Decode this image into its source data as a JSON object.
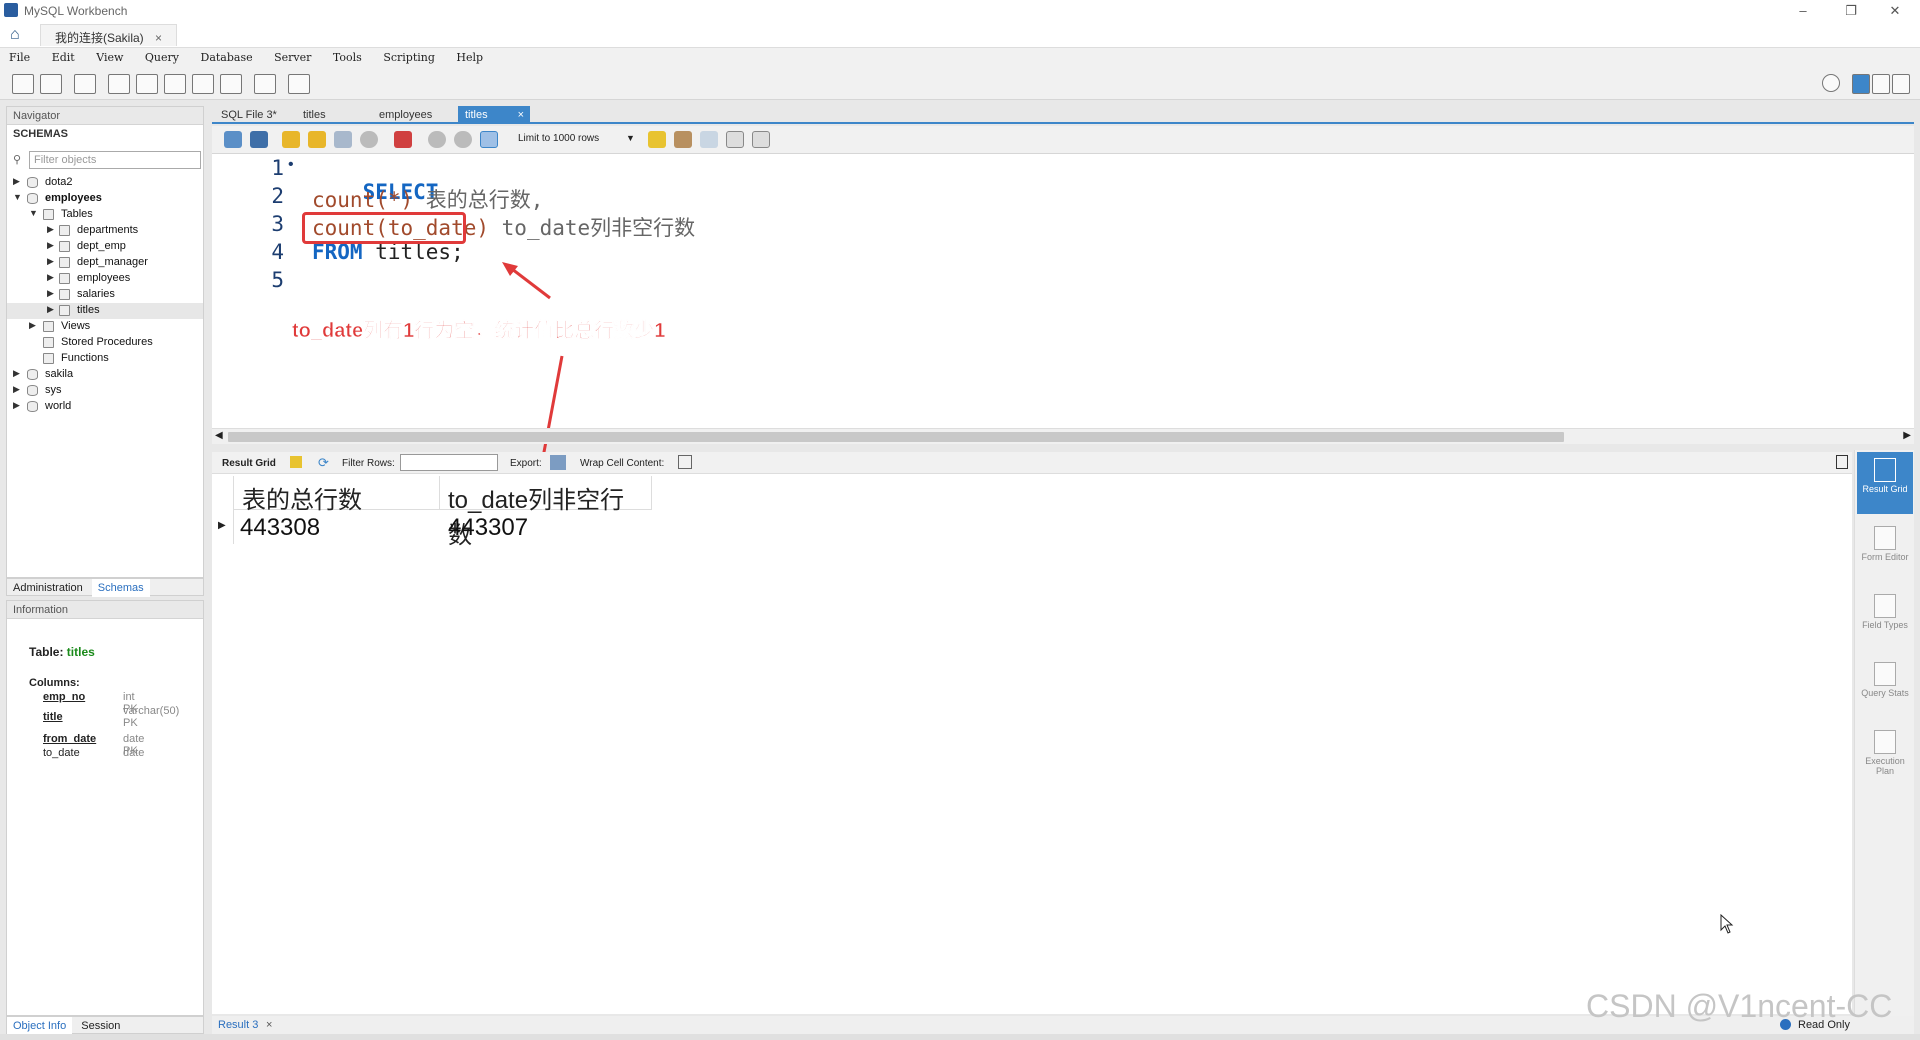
{
  "window": {
    "title": "MySQL Workbench",
    "minimize": "–",
    "restore": "❐",
    "close": "✕"
  },
  "connection_tab": {
    "label": "我的连接(Sakila)",
    "close": "×"
  },
  "menu": [
    "File",
    "Edit",
    "View",
    "Query",
    "Database",
    "Server",
    "Tools",
    "Scripting",
    "Help"
  ],
  "navigator": {
    "header": "Navigator",
    "schemas_label": "SCHEMAS",
    "filter_placeholder": "Filter objects",
    "schemas": [
      {
        "name": "dota2",
        "expanded": false
      },
      {
        "name": "employees",
        "expanded": true,
        "bold": true,
        "groups": [
          {
            "name": "Tables",
            "expanded": true,
            "items": [
              "departments",
              "dept_emp",
              "dept_manager",
              "employees",
              "salaries",
              "titles"
            ],
            "selected": "titles"
          },
          {
            "name": "Views",
            "expanded": false
          },
          {
            "name": "Stored Procedures"
          },
          {
            "name": "Functions"
          }
        ]
      },
      {
        "name": "sakila",
        "expanded": false
      },
      {
        "name": "sys",
        "expanded": false
      },
      {
        "name": "world",
        "expanded": false
      }
    ],
    "tabs": [
      "Administration",
      "Schemas"
    ],
    "active_tab": "Schemas"
  },
  "information": {
    "header": "Information",
    "table_label": "Table:",
    "table_name": "titles",
    "columns_label": "Columns:",
    "columns": [
      {
        "name": "emp_no",
        "type": "int PK",
        "underline": true
      },
      {
        "name": "title",
        "type": "varchar(50) PK",
        "underline": true
      },
      {
        "name": "from_date",
        "type": "date PK",
        "underline": true
      },
      {
        "name": "to_date",
        "type": "date",
        "underline": false
      }
    ],
    "tabs": [
      "Object Info",
      "Session"
    ]
  },
  "sql_tabs": [
    {
      "label": "SQL File 3*",
      "active": false
    },
    {
      "label": "titles",
      "active": false
    },
    {
      "label": "employees",
      "active": false
    },
    {
      "label": "titles",
      "active": true,
      "close": "×"
    }
  ],
  "editor_toolbar": {
    "limit_label": "Limit to 1000 rows"
  },
  "editor": {
    "lines": [
      {
        "n": "1",
        "marker": "•"
      },
      {
        "n": "2"
      },
      {
        "n": "3"
      },
      {
        "n": "4"
      },
      {
        "n": "5"
      }
    ],
    "line1_kw": "SELECT",
    "line2_fn": "count(*)",
    "line2_alias": " 表的总行数,",
    "line3_fn": "count(to_date)",
    "line3_alias": " to_date列非空行数",
    "line4_kw": "FROM",
    "line4_rest": " titles;"
  },
  "annotation": {
    "text": "to_date列有1行为空，统计值比总行数少1",
    "color": "#e03a3a"
  },
  "result_toolbar": {
    "result_grid": "Result Grid",
    "filter_rows": "Filter Rows:",
    "export": "Export:",
    "wrap": "Wrap Cell Content:"
  },
  "result_grid": {
    "columns": [
      "表的总行数",
      "to_date列非空行数"
    ],
    "rows": [
      [
        "443308",
        "443307"
      ]
    ]
  },
  "right_panel": [
    {
      "label": "Result Grid",
      "active": true
    },
    {
      "label": "Form Editor",
      "active": false
    },
    {
      "label": "Field Types",
      "active": false
    },
    {
      "label": "Query Stats",
      "active": false
    },
    {
      "label": "Execution Plan",
      "active": false
    }
  ],
  "bottom": {
    "result_tab": "Result 3",
    "close": "×",
    "status": "Read Only"
  },
  "watermark": "CSDN @V1ncent-CC"
}
